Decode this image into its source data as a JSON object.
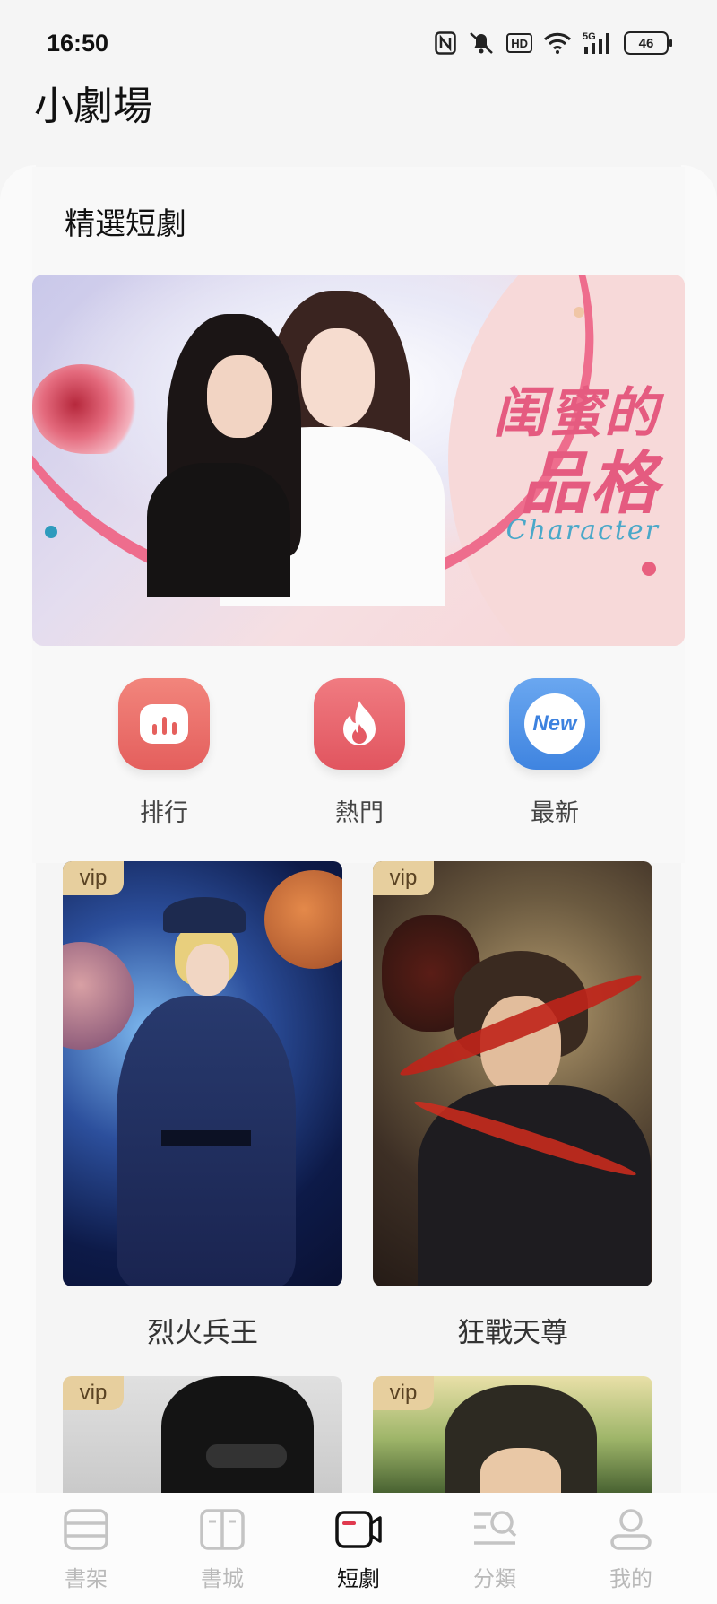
{
  "status": {
    "time": "16:50",
    "battery": "46",
    "hd": "HD",
    "network": "5G"
  },
  "page": {
    "title": "小劇場",
    "section_title": "精選短劇"
  },
  "banner": {
    "title_line1": "闺蜜的",
    "title_line2": "品格",
    "subtitle": "Character"
  },
  "quick_actions": [
    {
      "label": "排行",
      "icon": "bar-chart-icon"
    },
    {
      "label": "熱門",
      "icon": "flame-icon"
    },
    {
      "label": "最新",
      "icon": "new-badge-icon"
    }
  ],
  "dramas": [
    {
      "title": "烈火兵王",
      "badge": "vip"
    },
    {
      "title": "狂戰天尊",
      "badge": "vip"
    },
    {
      "title": "",
      "badge": "vip"
    },
    {
      "title": "",
      "badge": "vip"
    }
  ],
  "nav": [
    {
      "label": "書架",
      "icon": "bookshelf-icon"
    },
    {
      "label": "書城",
      "icon": "book-open-icon"
    },
    {
      "label": "短劇",
      "icon": "video-camera-icon",
      "active": true
    },
    {
      "label": "分類",
      "icon": "category-search-icon"
    },
    {
      "label": "我的",
      "icon": "profile-icon"
    }
  ],
  "colors": {
    "accent": "#e05063",
    "vip": "#e7cf9e",
    "nav_inactive": "#b9b9b9"
  }
}
